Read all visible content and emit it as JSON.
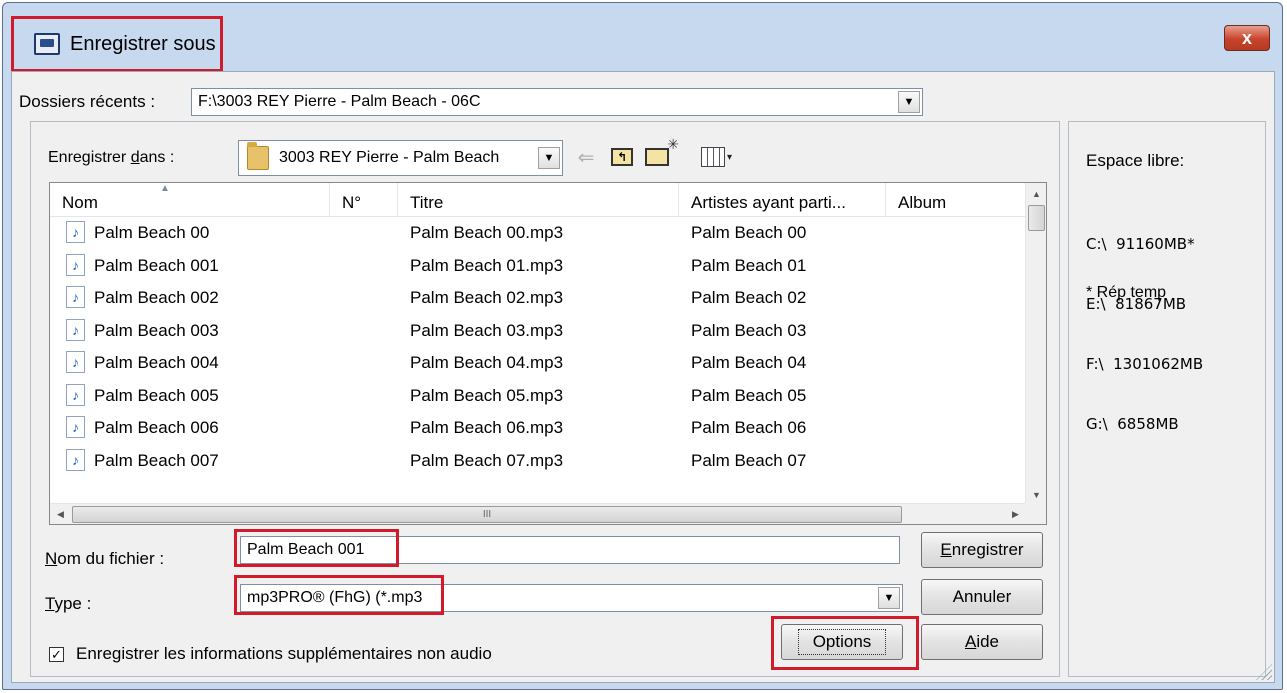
{
  "window": {
    "title": "Enregistrer sous",
    "close_label": "x"
  },
  "recent": {
    "label": "Dossiers récents :",
    "value": "F:\\3003 REY Pierre - Palm Beach - 06C",
    "arrow": "▼"
  },
  "save_in": {
    "label_pre": "Enregistrer ",
    "label_u": "d",
    "label_post": "ans :",
    "value": "3003 REY Pierre - Palm Beach",
    "arrow": "▼"
  },
  "toolbar": {
    "back_glyph": "⇐",
    "up_glyph": "↰",
    "views_arrow": "▾"
  },
  "columns": [
    "Nom",
    "N°",
    "Titre",
    "Artistes ayant parti...",
    "Album"
  ],
  "files": [
    {
      "name": "Palm Beach 00",
      "num": "",
      "title": "Palm Beach 00.mp3",
      "artist": "Palm Beach 00",
      "album": ""
    },
    {
      "name": "Palm Beach 001",
      "num": "",
      "title": "Palm Beach 01.mp3",
      "artist": "Palm Beach 01",
      "album": ""
    },
    {
      "name": "Palm Beach 002",
      "num": "",
      "title": "Palm Beach 02.mp3",
      "artist": "Palm Beach 02",
      "album": ""
    },
    {
      "name": "Palm Beach 003",
      "num": "",
      "title": "Palm Beach 03.mp3",
      "artist": "Palm Beach 03",
      "album": ""
    },
    {
      "name": "Palm Beach 004",
      "num": "",
      "title": "Palm Beach 04.mp3",
      "artist": "Palm Beach 04",
      "album": ""
    },
    {
      "name": "Palm Beach 005",
      "num": "",
      "title": "Palm Beach 05.mp3",
      "artist": "Palm Beach 05",
      "album": ""
    },
    {
      "name": "Palm Beach 006",
      "num": "",
      "title": "Palm Beach 06.mp3",
      "artist": "Palm Beach 06",
      "album": ""
    },
    {
      "name": "Palm Beach 007",
      "num": "",
      "title": "Palm Beach 07.mp3",
      "artist": "Palm Beach 07",
      "album": ""
    }
  ],
  "scroll": {
    "up": "▲",
    "down": "▼",
    "left": "◀",
    "right": "▶",
    "thumb_grip": "III"
  },
  "filename": {
    "label_u": "N",
    "label_post": "om du fichier :",
    "value": "Palm Beach 001"
  },
  "type": {
    "label_u": "T",
    "label_post": "ype :",
    "value": "mp3PRO® (FhG) (*.mp3",
    "arrow": "▼"
  },
  "checkbox": {
    "checked_glyph": "✓",
    "label": "Enregistrer les informations supplémentaires non audio"
  },
  "buttons": {
    "save_u": "E",
    "save_post": "nregistrer",
    "cancel": "Annuler",
    "options": "Options",
    "help_u": "A",
    "help_post": "ide"
  },
  "side": {
    "title": "Espace libre:",
    "drives": [
      "C:\\  91160MB*",
      "E:\\  81867MB",
      "F:\\  1301062MB",
      "G:\\  6858MB"
    ],
    "note": "* Rép temp"
  },
  "colors": {
    "highlight_red": "#d11a2a",
    "window_frame": "#c7d9ee",
    "close_button": "#c8432b"
  }
}
